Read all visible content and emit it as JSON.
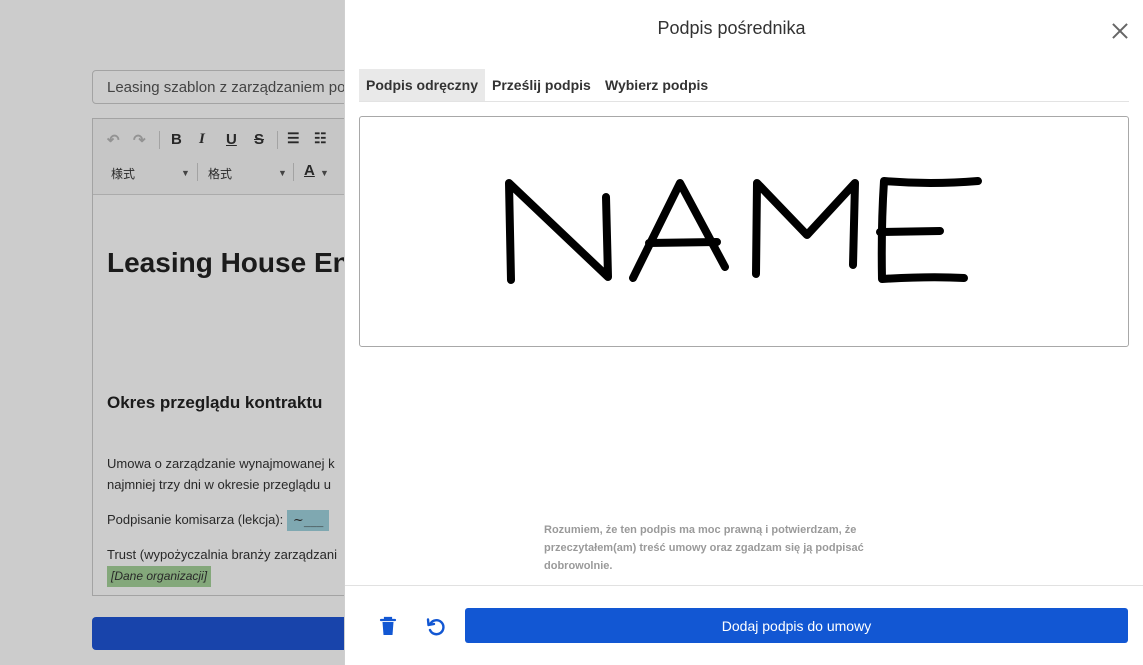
{
  "background": {
    "title_input_value": "Leasing szablon z zarządzaniem pow",
    "toolbar": {
      "undo_icon": "undo-icon",
      "redo_icon": "redo-icon",
      "bold": "B",
      "italic": "I",
      "underline": "U",
      "strike": "S",
      "style_combo": "様式",
      "format_combo": "格式",
      "font_color": "A"
    },
    "doc": {
      "heading": "Leasing House Ent",
      "section_heading": "Okres przeglądu kontraktu",
      "para_line1": "Umowa o zarządzanie wynajmowanej k",
      "para_line2": "najmniej trzy dni w okresie przeglądu u",
      "signing_label": "Podpisanie komisarza (lekcja):",
      "signing_chip": "~___",
      "trust_line": "Trust (wypożyczalnia branży zarządzani",
      "org_placeholder": "[Dane organizacji]"
    }
  },
  "modal": {
    "title": "Podpis pośrednika",
    "tabs": [
      {
        "label": "Podpis odręczny",
        "active": true
      },
      {
        "label": "Prześlij podpis",
        "active": false
      },
      {
        "label": "Wybierz podpis",
        "active": false
      }
    ],
    "consent_text": "Rozumiem, że ten podpis ma moc prawną i potwierdzam, że przeczytałem(am) treść umowy oraz zgadzam się ją podpisać dobrowolnie.",
    "primary_button": "Dodaj podpis do umowy",
    "colors": {
      "primary": "#1257d3",
      "ink": "#000000"
    }
  }
}
